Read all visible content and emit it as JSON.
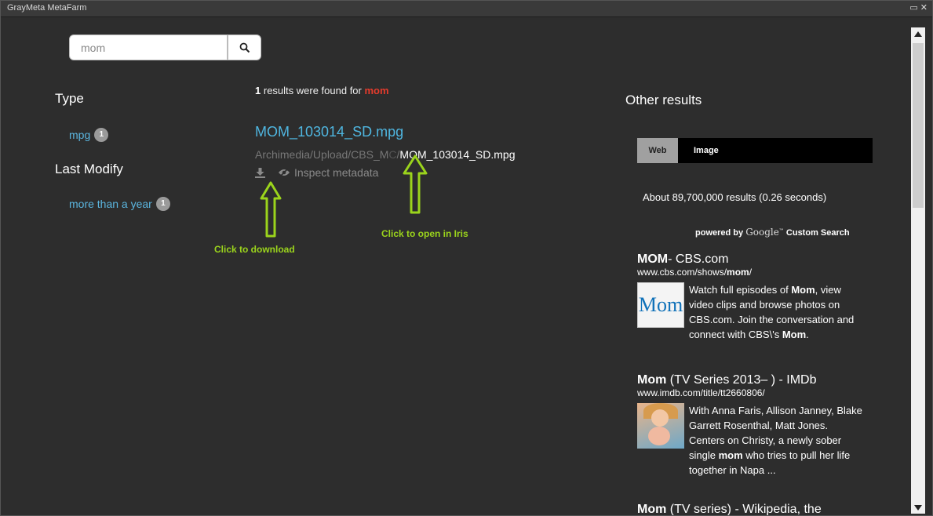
{
  "window": {
    "title": "GrayMeta MetaFarm",
    "controls": [
      "▭",
      "✕"
    ]
  },
  "search": {
    "value": "mom",
    "placeholder": ""
  },
  "facets": {
    "type_heading": "Type",
    "type_items": [
      {
        "label": "mpg",
        "count": "1"
      }
    ],
    "modify_heading": "Last Modify",
    "modify_items": [
      {
        "label": "more than a year",
        "count": "1"
      }
    ]
  },
  "results": {
    "count": "1",
    "summary_text": "results were found for",
    "query": "mom",
    "items": [
      {
        "title": "MOM_103014_SD.mpg",
        "path_prefix": "Archimedia/Upload/CBS_M",
        "path_obscured": "C",
        "path_file": "MOM_103014_SD.mpg",
        "inspect_label": "Inspect metadata"
      }
    ]
  },
  "annotations": {
    "download": "Click to download",
    "open_iris": "Click to open in Iris"
  },
  "other": {
    "heading": "Other results",
    "tabs": [
      "Web",
      "Image"
    ],
    "active_tab": "Web",
    "result_count": "About 89,700,000 results (0.26 seconds)",
    "powered_by": "powered by",
    "powered_google": "Google",
    "powered_custom": "Custom Search",
    "items": [
      {
        "title_bold": "MOM",
        "title_rest": "- CBS.com",
        "url_prefix": "www.cbs.com/shows/",
        "url_bold": "mom",
        "url_suffix": "/",
        "desc_1": "Watch full episodes of ",
        "desc_bold_1": "Mom",
        "desc_2": ", view video clips and browse photos on CBS.com. Join the conversation and connect with CBS\\'s ",
        "desc_bold_2": "Mom",
        "desc_3": ".",
        "thumb_text": "Mom"
      },
      {
        "title_bold": "Mom",
        "title_rest": " (TV Series 2013– ) - IMDb",
        "url_prefix": "www.imdb.com/title/tt2660806/",
        "url_bold": "",
        "url_suffix": "",
        "desc_1": "With Anna Faris, Allison Janney, Blake Garrett Rosenthal, Matt Jones. Centers on Christy, a newly sober single ",
        "desc_bold_1": "mom",
        "desc_2": " who tries to pull her life together in Napa ...",
        "desc_bold_2": "",
        "desc_3": ""
      },
      {
        "title_bold": "Mom",
        "title_rest": " (TV series) - Wikipedia, the"
      }
    ]
  },
  "colors": {
    "accent": "#4fb6e0",
    "query": "#e53b2c",
    "annotation": "#9bd41c",
    "background": "#2d2d2d"
  }
}
